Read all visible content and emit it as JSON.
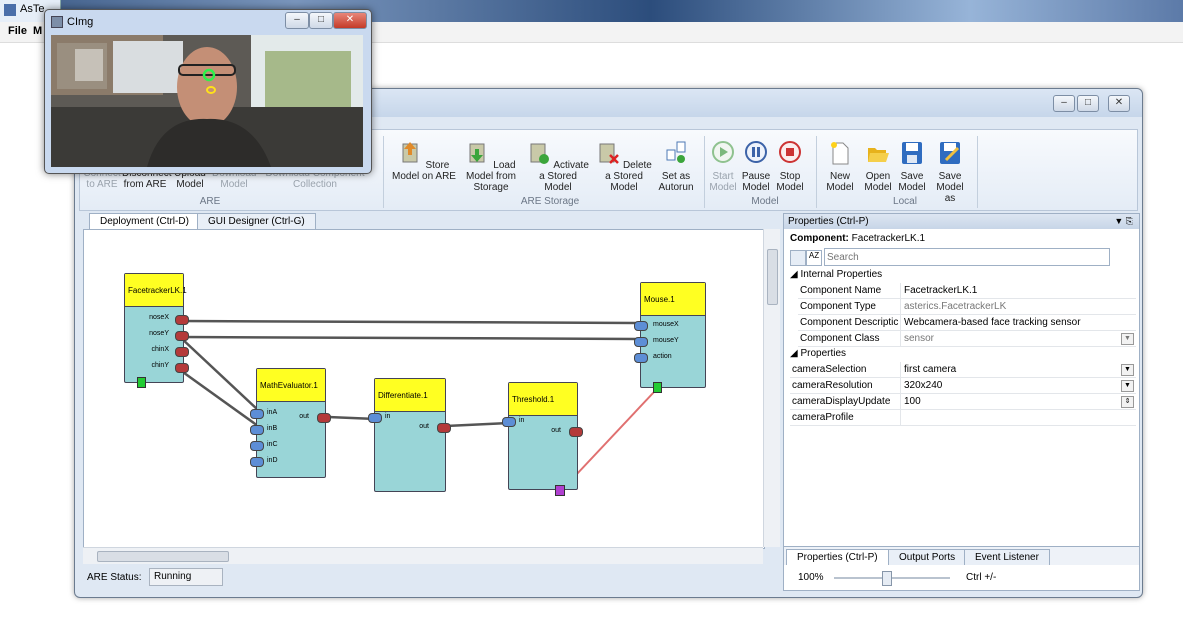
{
  "taskbar": {
    "app_title": "AsTe"
  },
  "menu": {
    "file": "File",
    "fragment": "M"
  },
  "webcam_window": {
    "title": "CImg"
  },
  "ribbon": {
    "are_group": {
      "label": "ARE",
      "buttons": [
        {
          "label": "Connect to ARE",
          "enabled": false
        },
        {
          "label": "Disconnect from ARE",
          "enabled": true
        },
        {
          "label": "Upload Model",
          "enabled": true
        },
        {
          "label": "Download Model",
          "enabled": false
        },
        {
          "label": "Download Component Collection",
          "enabled": false
        }
      ]
    },
    "storage_group": {
      "label": "ARE Storage",
      "buttons": [
        {
          "label": "Store Model on ARE"
        },
        {
          "label": "Load Model from Storage"
        },
        {
          "label": "Activate a Stored Model"
        },
        {
          "label": "Delete a Stored Model"
        },
        {
          "label": "Set as Autorun"
        }
      ]
    },
    "model_group": {
      "label": "Model",
      "buttons": [
        {
          "label": "Start Model",
          "enabled": false
        },
        {
          "label": "Pause Model",
          "enabled": true
        },
        {
          "label": "Stop Model",
          "enabled": true
        }
      ]
    },
    "local_group": {
      "label": "Local",
      "buttons": [
        {
          "label": "New Model"
        },
        {
          "label": "Open Model"
        },
        {
          "label": "Save Model"
        },
        {
          "label": "Save Model as"
        }
      ]
    }
  },
  "tabs": {
    "deployment": "Deployment (Ctrl-D)",
    "gui_designer": "GUI Designer (Ctrl-G)"
  },
  "components": {
    "facetracker": {
      "name": "FacetrackerLK.1",
      "ports": [
        "noseX",
        "noseY",
        "chinX",
        "chinY"
      ]
    },
    "mouse": {
      "name": "Mouse.1",
      "ports": [
        "mouseX",
        "mouseY",
        "action"
      ]
    },
    "math": {
      "name": "MathEvaluator.1",
      "ports_in": [
        "inA",
        "inB",
        "inC",
        "inD"
      ],
      "port_out": "out"
    },
    "diff": {
      "name": "Differentiate.1",
      "port_in": "in",
      "port_out": "out"
    },
    "threshold": {
      "name": "Threshold.1",
      "port_in": "in",
      "port_out": "out"
    }
  },
  "status": {
    "label": "ARE Status:",
    "value": "Running"
  },
  "properties": {
    "header": "Properties (Ctrl-P)",
    "component_label": "Component:",
    "component_value": "FacetrackerLK.1",
    "search_placeholder": "Search",
    "internal_section": "Internal Properties",
    "internal": [
      {
        "key": "Component Name",
        "value": "FacetrackerLK.1"
      },
      {
        "key": "Component Type",
        "value": "asterics.FacetrackerLK"
      },
      {
        "key": "Component Descriptic",
        "value": "Webcamera-based face tracking sensor"
      },
      {
        "key": "Component Class",
        "value": "sensor"
      }
    ],
    "props_section": "Properties",
    "props": [
      {
        "key": "cameraSelection",
        "value": "first camera"
      },
      {
        "key": "cameraResolution",
        "value": "320x240"
      },
      {
        "key": "cameraDisplayUpdate",
        "value": "100"
      },
      {
        "key": "cameraProfile",
        "value": ""
      }
    ],
    "bottom_tabs": [
      "Properties (Ctrl-P)",
      "Output Ports",
      "Event Listener"
    ],
    "zoom": "100%",
    "zoom_hint": "Ctrl +/-"
  },
  "colors": {
    "component_header": "#ffff22",
    "component_body": "#99d5d7",
    "in_port": "#5d8ed6",
    "out_port": "#b43a3a",
    "event_link": "#e07070"
  }
}
